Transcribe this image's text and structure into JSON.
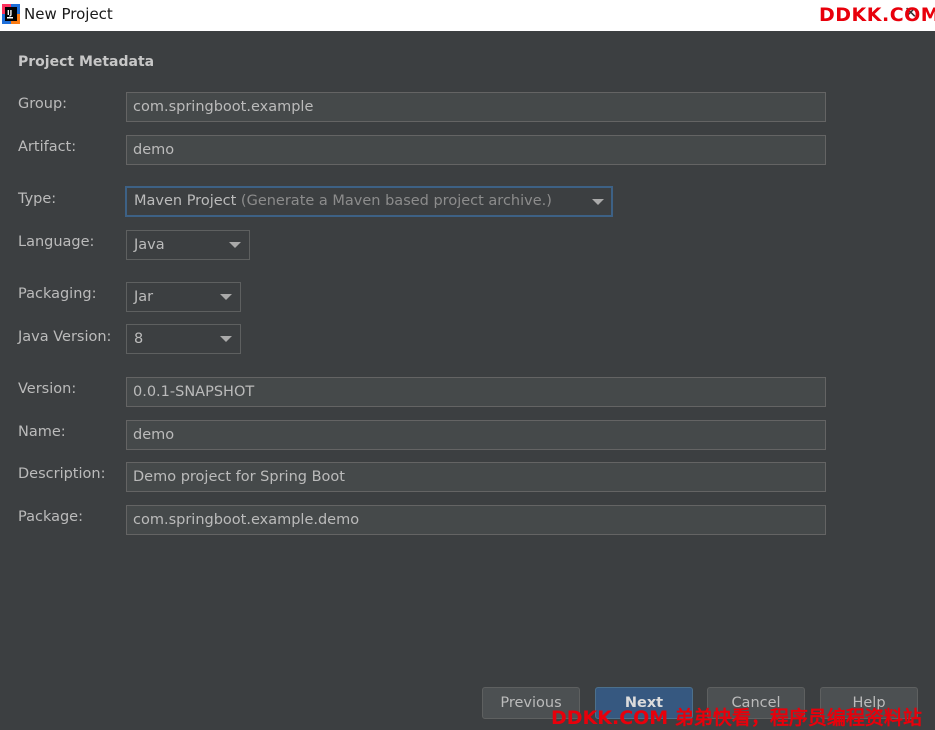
{
  "window": {
    "title": "New Project",
    "close": "✕"
  },
  "watermark": {
    "top": "DDKK.COM",
    "bottom": "DDKK.COM 弟弟快看，程序员编程资料站"
  },
  "section_title": "Project Metadata",
  "fields": {
    "group": {
      "label": "Group:",
      "value": "com.springboot.example"
    },
    "artifact": {
      "label": "Artifact:",
      "value": "demo"
    },
    "type": {
      "label": "Type:",
      "value": "Maven Project",
      "description": "(Generate a Maven based project archive.)"
    },
    "language": {
      "label": "Language:",
      "value": "Java"
    },
    "packaging": {
      "label": "Packaging:",
      "value": "Jar"
    },
    "java_version": {
      "label": "Java Version:",
      "value": "8"
    },
    "version": {
      "label": "Version:",
      "value": "0.0.1-SNAPSHOT"
    },
    "name": {
      "label": "Name:",
      "value": "demo"
    },
    "description": {
      "label": "Description:",
      "value": "Demo project for Spring Boot"
    },
    "package": {
      "label": "Package:",
      "value": "com.springboot.example.demo"
    }
  },
  "buttons": {
    "previous": "Previous",
    "next": "Next",
    "cancel": "Cancel",
    "help": "Help"
  },
  "colors": {
    "background": "#3c3f41",
    "field_bg": "#45494a",
    "primary_button": "#365880",
    "watermark": "#e8000b"
  }
}
